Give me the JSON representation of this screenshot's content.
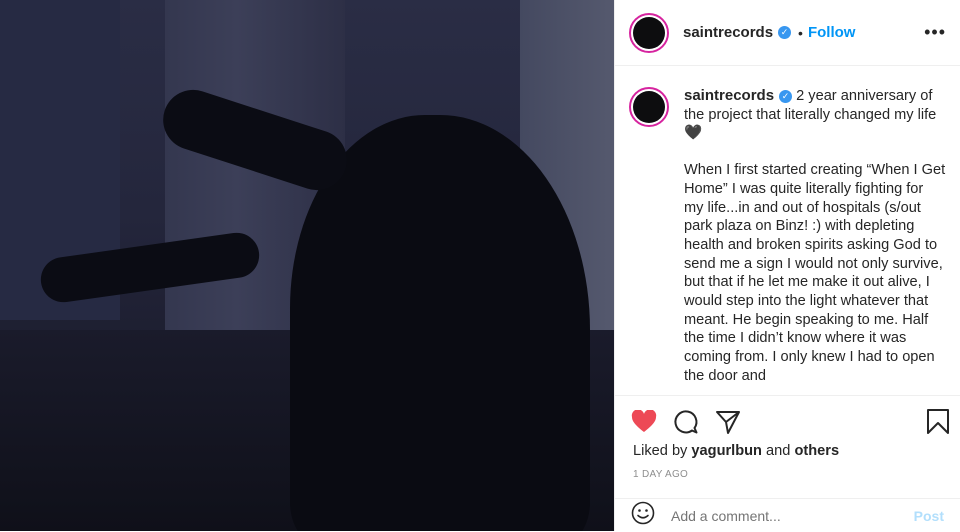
{
  "post": {
    "username": "saintrecords",
    "follow_label": "Follow",
    "separator": "•",
    "more_label": "•••"
  },
  "caption": {
    "username": "saintrecords",
    "intro": "2 year anniversary of the project that literally changed my life 🖤",
    "body": "When I first started creating “When I Get Home” I was quite literally fighting for my life...in and out of hospitals (s/out park plaza on Binz! :) with depleting health and broken spirits asking God to send me a sign I would not only survive, but that if he let me make it out alive, I would step into the light whatever that meant. He begin speaking to me. Half the time I didn’t know where it was coming from. I only knew I had to open the door and"
  },
  "likes": {
    "prefix": "Liked by",
    "user": "yagurlbun",
    "and": "and",
    "others": "others"
  },
  "timestamp": "1 DAY AGO",
  "comment": {
    "placeholder": "Add a comment...",
    "post_label": "Post"
  },
  "colors": {
    "like": "#ed4956",
    "accent": "#0095f6",
    "verified": "#3897f0"
  }
}
